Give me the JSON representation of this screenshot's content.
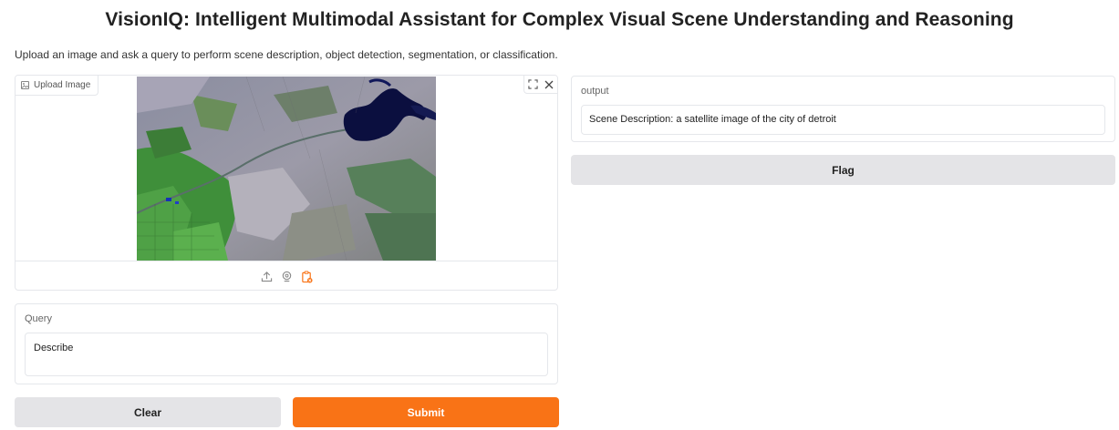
{
  "header": {
    "title": "VisionIQ: Intelligent Multimodal Assistant for Complex Visual Scene Understanding and Reasoning",
    "subtitle": "Upload an image and ask a query to perform scene description, object detection, segmentation, or classification."
  },
  "image_input": {
    "label": "Upload Image",
    "label_icon": "image-icon",
    "controls": [
      "fullscreen-icon",
      "close-icon"
    ],
    "sources": [
      "upload-icon",
      "webcam-icon",
      "clipboard-icon"
    ],
    "active_source": "clipboard-icon"
  },
  "query": {
    "label": "Query",
    "value": "Describe"
  },
  "output": {
    "label": "output",
    "value": "Scene Description: a satellite image of the city of detroit"
  },
  "buttons": {
    "clear": "Clear",
    "submit": "Submit",
    "flag": "Flag"
  },
  "colors": {
    "accent": "#f97316",
    "secondary_button": "#e4e4e7",
    "border": "#e5e7eb"
  }
}
